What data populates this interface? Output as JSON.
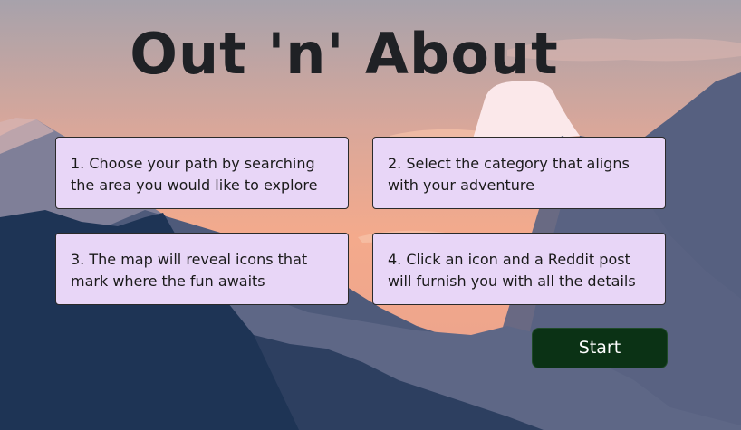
{
  "app": {
    "title": "Out 'n' About"
  },
  "steps": [
    {
      "text": "1. Choose your path by searching the area you would like to explore"
    },
    {
      "text": "2. Select the category that aligns with your adventure"
    },
    {
      "text": "3. The map will reveal icons that mark where the fun awaits"
    },
    {
      "text": "4. Click an icon and a Reddit post will furnish you with all the details"
    }
  ],
  "actions": {
    "start_label": "Start"
  },
  "colors": {
    "card_background": "#e8d6f7",
    "start_button": "#0b3215",
    "title_text": "#1f2125",
    "sky_top": "#a7a2ab",
    "sky_glow": "#f4aa8c",
    "mountain_far": "#5b6480",
    "mountain_near": "#1f3455"
  }
}
